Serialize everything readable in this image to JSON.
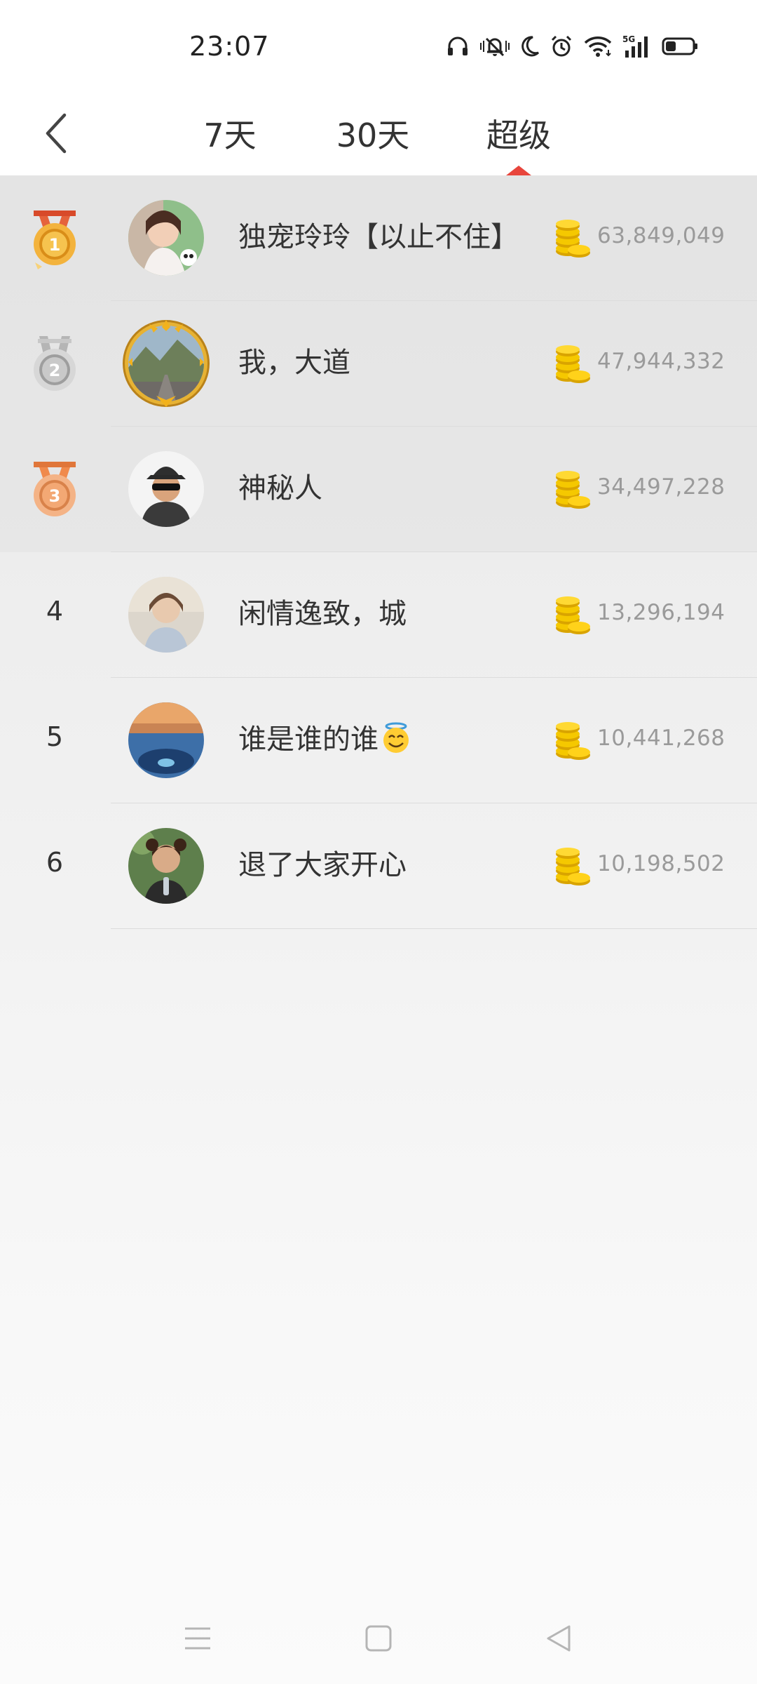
{
  "status_bar": {
    "time": "23:07",
    "icons": [
      "headphones-icon",
      "muted-bell-icon",
      "moon-icon",
      "alarm-icon",
      "wifi-icon",
      "5g-signal-icon",
      "battery-icon"
    ],
    "network_label": "5G"
  },
  "header": {
    "back_icon": "chevron-left-icon",
    "tabs": [
      {
        "label": "7天",
        "active": false
      },
      {
        "label": "30天",
        "active": false
      },
      {
        "label": "超级",
        "active": true
      }
    ],
    "accent_color": "#e8453c"
  },
  "ranking": [
    {
      "rank": 1,
      "rank_label": "1",
      "badge": "gold-medal-icon",
      "name": "独宠玲玲【以止不住】",
      "coins": "63,849,049"
    },
    {
      "rank": 2,
      "rank_label": "2",
      "badge": "silver-medal-icon",
      "name": "我，大道",
      "coins": "47,944,332"
    },
    {
      "rank": 3,
      "rank_label": "3",
      "badge": "bronze-medal-icon",
      "name": "神秘人",
      "coins": "34,497,228"
    },
    {
      "rank": 4,
      "rank_label": "4",
      "name": "闲情逸致，城",
      "coins": "13,296,194"
    },
    {
      "rank": 5,
      "rank_label": "5",
      "name": "谁是谁的谁",
      "name_emoji": "smiling-halo-emoji",
      "coins": "10,441,268"
    },
    {
      "rank": 6,
      "rank_label": "6",
      "name": "退了大家开心",
      "coins": "10,198,502"
    }
  ],
  "coin_icon": "gold-coins-icon",
  "nav_bar": {
    "icons": [
      "menu-icon",
      "home-square-icon",
      "back-triangle-icon"
    ]
  }
}
